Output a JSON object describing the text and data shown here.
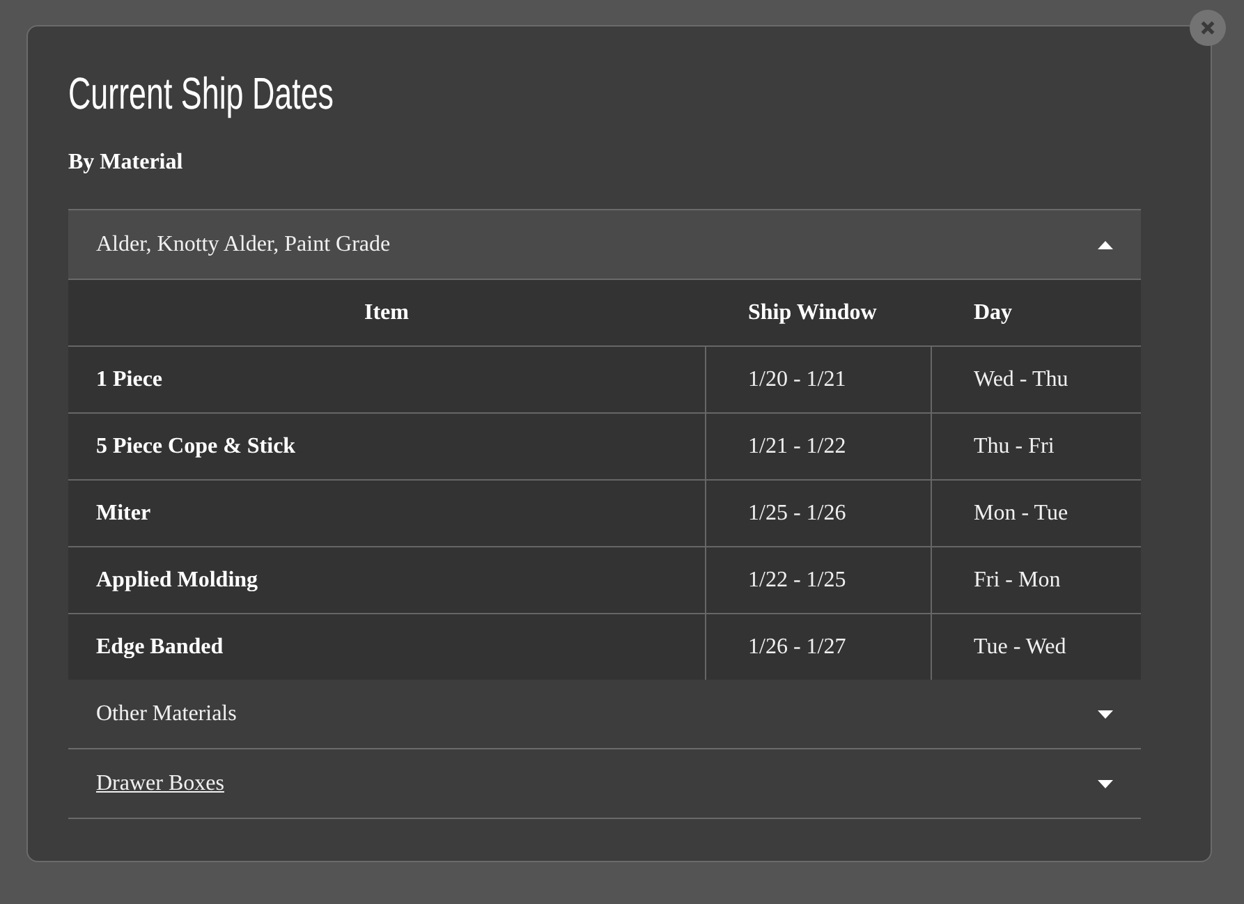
{
  "dialog": {
    "title": "Current Ship Dates",
    "subtitle": "By Material"
  },
  "sections": [
    {
      "label": "Alder, Knotty Alder, Paint Grade",
      "kind": "plain",
      "expanded": true,
      "table": {
        "columns": [
          "Item",
          "Ship Window",
          "Day"
        ],
        "rows": [
          [
            "1 Piece",
            "1/20 - 1/21",
            "Wed - Thu"
          ],
          [
            "5 Piece Cope & Stick",
            "1/21 - 1/22",
            "Thu - Fri"
          ],
          [
            "Miter",
            "1/25 - 1/26",
            "Mon - Tue"
          ],
          [
            "Applied Molding",
            "1/22 - 1/25",
            "Fri - Mon"
          ],
          [
            "Edge Banded",
            "1/26 - 1/27",
            "Tue - Wed"
          ]
        ]
      }
    },
    {
      "label": "Other Materials",
      "kind": "plain",
      "expanded": false
    },
    {
      "label": "Drawer Boxes",
      "kind": "link",
      "expanded": false
    }
  ]
}
